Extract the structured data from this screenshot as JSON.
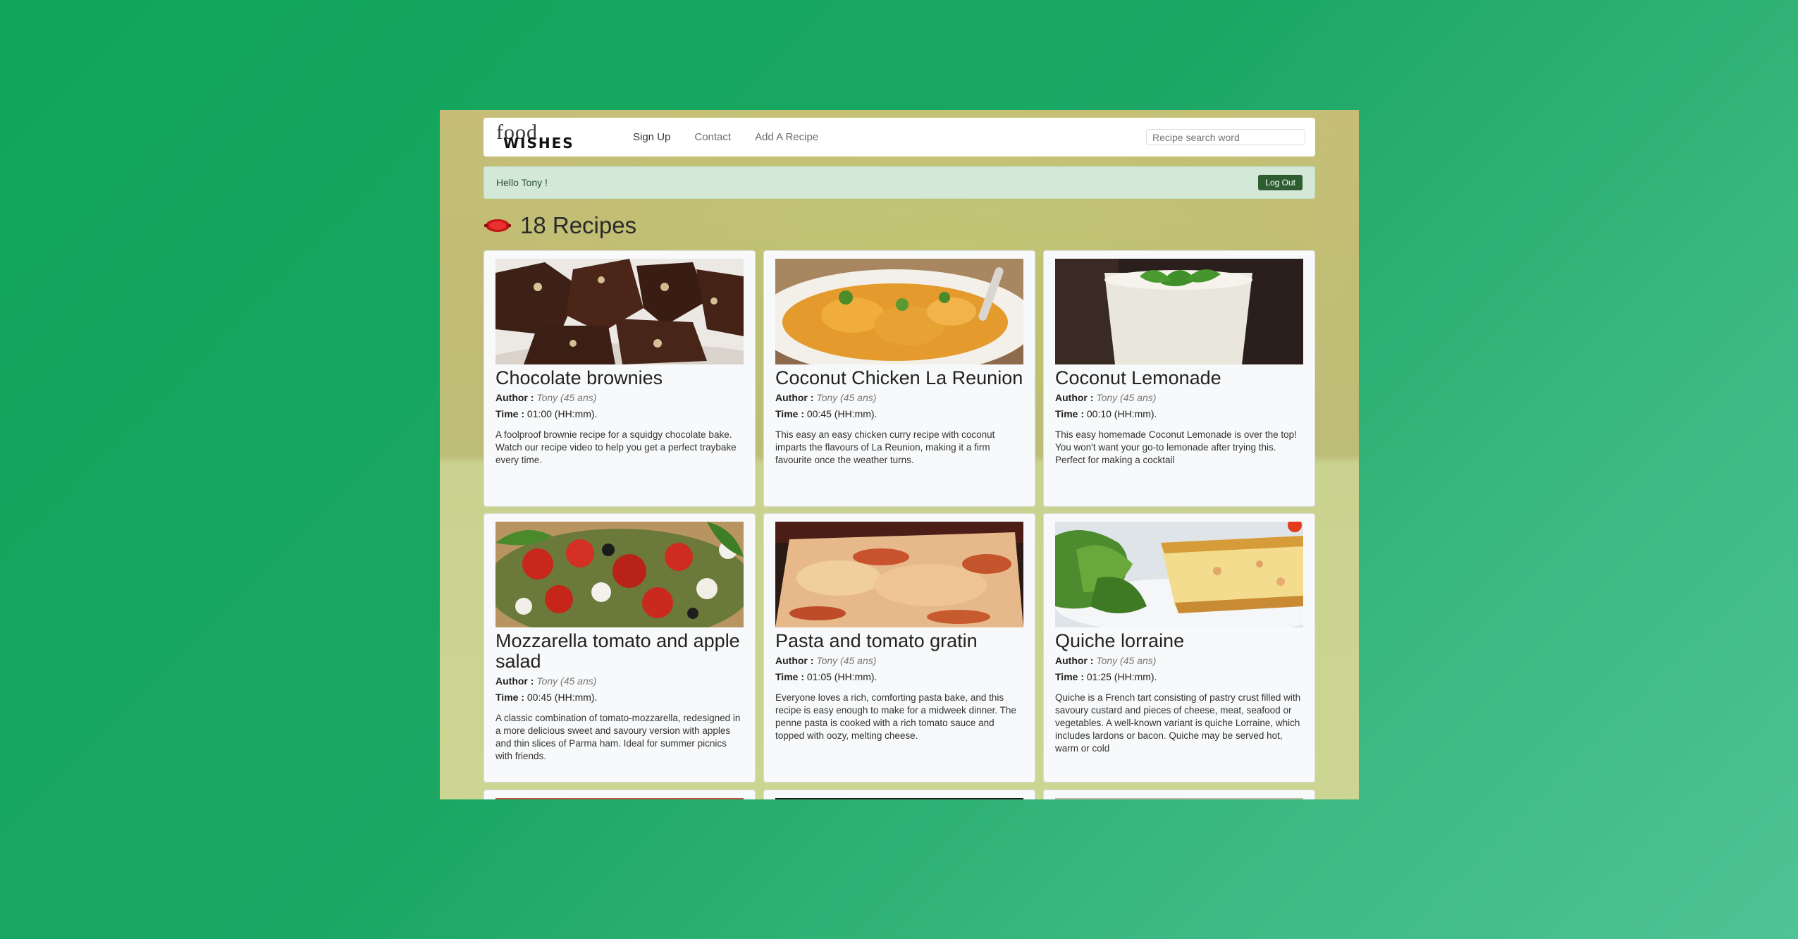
{
  "brand": {
    "line1": "food",
    "line2": "WISHES"
  },
  "nav": {
    "items": [
      "Sign Up",
      "Contact",
      "Add A Recipe"
    ]
  },
  "search": {
    "placeholder": "Recipe search word"
  },
  "alert": {
    "greeting": "Hello Tony !",
    "logout": "Log Out"
  },
  "heading": {
    "count_label": "18 Recipes",
    "icon": "dish-icon"
  },
  "labels": {
    "author": "Author :",
    "time": "Time :"
  },
  "recipes": [
    {
      "title": "Chocolate brownies",
      "author": "Tony (45 ans)",
      "time": "01:00 (HH:mm).",
      "description": "A foolproof brownie recipe for a squidgy chocolate bake. Watch our recipe video to help you get a perfect traybake every time."
    },
    {
      "title": "Coconut Chicken La Reunion",
      "author": "Tony (45 ans)",
      "time": "00:45 (HH:mm).",
      "description": "This easy an easy chicken curry recipe with coconut imparts the flavours of La Reunion, making it a firm favourite once the weather turns."
    },
    {
      "title": "Coconut Lemonade",
      "author": "Tony (45 ans)",
      "time": "00:10 (HH:mm).",
      "description": "This easy homemade Coconut Lemonade is over the top! You won't want your go-to lemonade after trying this. Perfect for making a cocktail"
    },
    {
      "title": "Mozzarella tomato and apple salad",
      "author": "Tony (45 ans)",
      "time": "00:45 (HH:mm).",
      "description": "A classic combination of tomato-mozzarella, redesigned in a more delicious sweet and savoury version with apples and thin slices of Parma ham. Ideal for summer picnics with friends."
    },
    {
      "title": "Pasta and tomato gratin",
      "author": "Tony (45 ans)",
      "time": "01:05 (HH:mm).",
      "description": "Everyone loves a rich, comforting pasta bake, and this recipe is easy enough to make for a midweek dinner. The penne pasta is cooked with a rich tomato sauce and topped with oozy, melting cheese."
    },
    {
      "title": "Quiche lorraine",
      "author": "Tony (45 ans)",
      "time": "01:25 (HH:mm).",
      "description": "Quiche is a French tart consisting of pastry crust filled with savoury custard and pieces of cheese, meat, seafood or vegetables. A well-known variant is quiche Lorraine, which includes lardons or bacon. Quiche may be served hot, warm or cold"
    }
  ]
}
